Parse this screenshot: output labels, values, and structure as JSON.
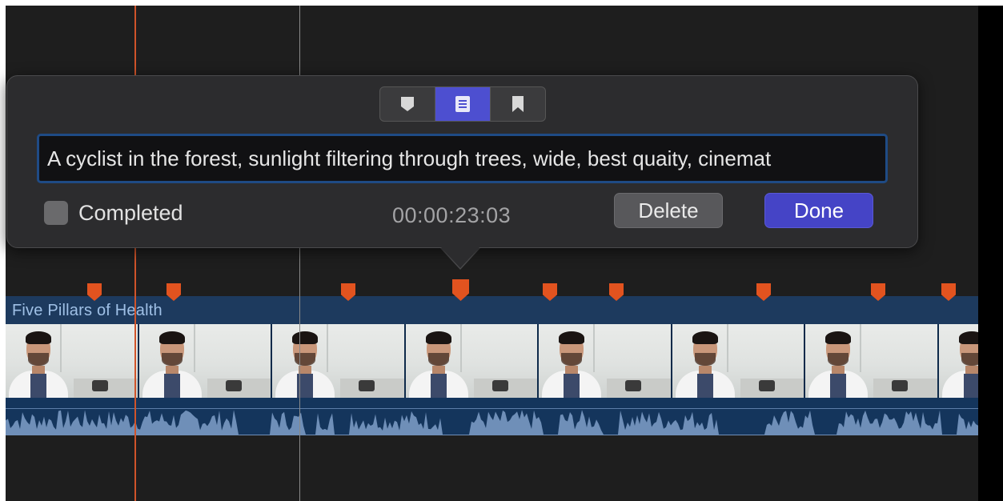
{
  "popover": {
    "segments": [
      {
        "icon": "marker-icon",
        "active": false
      },
      {
        "icon": "notes-icon",
        "active": true
      },
      {
        "icon": "bookmark-icon",
        "active": false
      }
    ],
    "note_text": "A cyclist in the forest, sunlight filtering through trees, wide, best quaity, cinemat",
    "completed_label": "Completed",
    "completed_checked": false,
    "timecode": "00:00:23:03",
    "delete_label": "Delete",
    "done_label": "Done"
  },
  "timeline": {
    "clip_title": "Five Pillars of Health",
    "marker_count": 9,
    "thumbnail_count": 8,
    "colors": {
      "marker": "#e2531f",
      "playhead": "#d0542a",
      "clip_header": "#1d3a5e",
      "accent": "#4d4fd0"
    }
  }
}
